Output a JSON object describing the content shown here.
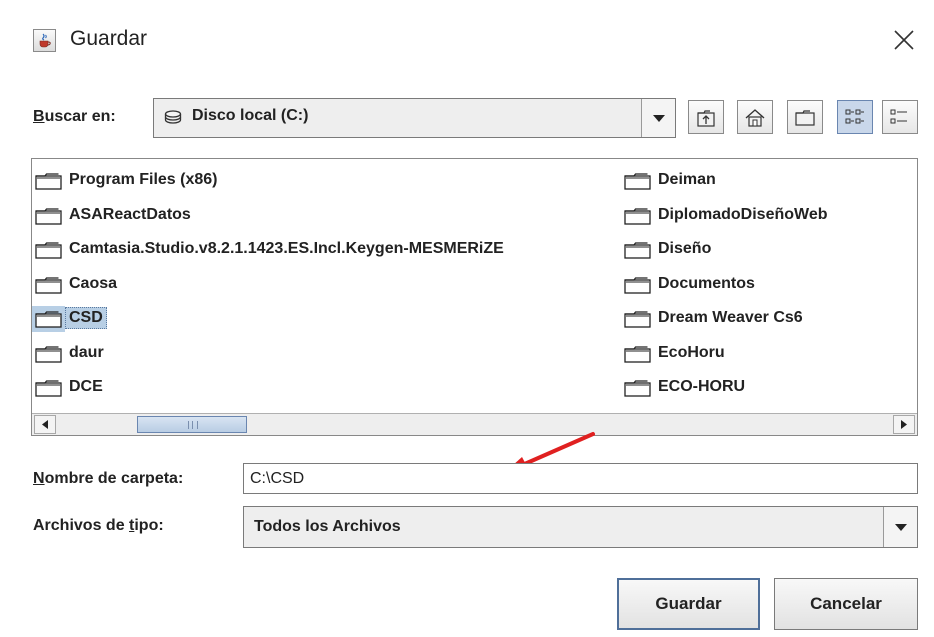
{
  "window": {
    "title": "Guardar",
    "app_icon": "java-cup-icon",
    "close_icon": "close-icon"
  },
  "look_in": {
    "label_underlined": "B",
    "label_rest": "uscar en:",
    "value": "Disco local (C:)",
    "value_icon": "drive-icon"
  },
  "toolbar": {
    "buttons": [
      "up-one-level-icon",
      "home-icon",
      "new-folder-icon",
      "list-view-icon",
      "details-view-icon"
    ],
    "selected": "list-view-icon"
  },
  "files": {
    "left_column": [
      "Program Files (x86)",
      "ASAReactDatos",
      "Camtasia.Studio.v8.2.1.1423.ES.Incl.Keygen-MESMERiZE",
      "Caosa",
      "CSD",
      "daur",
      "DCE"
    ],
    "right_column": [
      "Deiman",
      "DiplomadoDiseñoWeb",
      "Diseño",
      "Documentos",
      "Dream Weaver Cs6",
      "EcoHoru",
      "ECO-HORU"
    ],
    "selected": "CSD",
    "item_icon": "folder-icon"
  },
  "folder_name": {
    "label_underlined": "N",
    "label_rest": "ombre de carpeta:",
    "value": "C:\\CSD"
  },
  "file_type": {
    "label_prefix": "Archivos de ",
    "label_underlined": "t",
    "label_suffix": "ipo:",
    "value": "Todos los Archivos"
  },
  "buttons": {
    "save": "Guardar",
    "cancel": "Cancelar"
  },
  "annotation": {
    "arrow_color": "#e02020"
  },
  "colors": {
    "selection": "#b8cfe5",
    "accent_border": "#4f6f99"
  }
}
